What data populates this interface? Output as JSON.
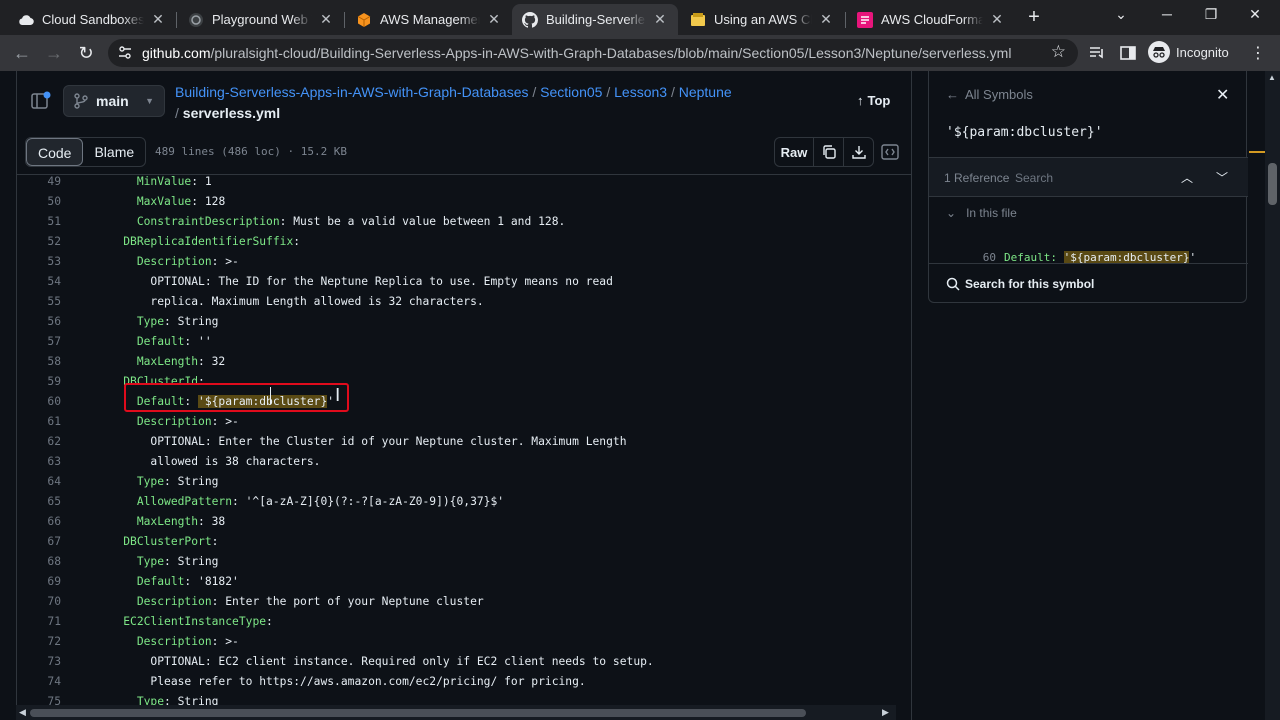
{
  "browser": {
    "tabs": [
      {
        "title": "Cloud Sandboxes - ",
        "icon": "cloud-icon",
        "active": false
      },
      {
        "title": "Playground Web Te",
        "icon": "playground-icon",
        "active": false
      },
      {
        "title": "AWS Management",
        "icon": "aws-cube-icon",
        "active": false
      },
      {
        "title": "Building-Serverless",
        "icon": "github-icon",
        "active": true
      },
      {
        "title": "Using an AWS Clou",
        "icon": "aws-doc-icon",
        "active": false
      },
      {
        "title": "AWS CloudFormatio",
        "icon": "cloudformation-icon",
        "active": false
      }
    ],
    "url_host": "github.com",
    "url_path": "/pluralsight-cloud/Building-Serverless-Apps-in-AWS-with-Graph-Databases/blob/main/Section05/Lesson3/Neptune/serverless.yml",
    "profile_label": "Incognito"
  },
  "repo": {
    "branch": "main",
    "breadcrumb": [
      {
        "label": "Building-Serverless-Apps-in-AWS-with-Graph-Databases"
      },
      {
        "label": "Section05"
      },
      {
        "label": "Lesson3"
      },
      {
        "label": "Neptune"
      }
    ],
    "separator": "/",
    "file_name": "serverless.yml",
    "top_label": "Top"
  },
  "file_toolbar": {
    "code_label": "Code",
    "blame_label": "Blame",
    "meta": "489 lines (486 loc) · 15.2 KB",
    "raw_label": "Raw"
  },
  "code_lines": [
    {
      "n": "49",
      "indent": "      ",
      "key": "MinValue",
      "rest": ": 1"
    },
    {
      "n": "50",
      "indent": "      ",
      "key": "MaxValue",
      "rest": ": 128"
    },
    {
      "n": "51",
      "indent": "      ",
      "key": "ConstraintDescription",
      "rest": ": Must be a valid value between 1 and 128."
    },
    {
      "n": "52",
      "indent": "    ",
      "key": "DBReplicaIdentifierSuffix",
      "rest": ":"
    },
    {
      "n": "53",
      "indent": "      ",
      "key": "Description",
      "rest": ": >-"
    },
    {
      "n": "54",
      "indent": "        ",
      "key": "",
      "rest": "OPTIONAL: The ID for the Neptune Replica to use. Empty means no read"
    },
    {
      "n": "55",
      "indent": "        ",
      "key": "",
      "rest": "replica. Maximum Length allowed is 32 characters."
    },
    {
      "n": "56",
      "indent": "      ",
      "key": "Type",
      "rest": ": String"
    },
    {
      "n": "57",
      "indent": "      ",
      "key": "Default",
      "rest": ": ''"
    },
    {
      "n": "58",
      "indent": "      ",
      "key": "MaxLength",
      "rest": ": 32"
    },
    {
      "n": "59",
      "indent": "    ",
      "key": "DBClusterId",
      "rest": ":"
    },
    {
      "n": "60",
      "indent": "      ",
      "key": "Default",
      "rest": ": ",
      "hl": "'${param:dbcluster}",
      "tail": "'"
    },
    {
      "n": "61",
      "indent": "      ",
      "key": "Description",
      "rest": ": >-"
    },
    {
      "n": "62",
      "indent": "        ",
      "key": "",
      "rest": "OPTIONAL: Enter the Cluster id of your Neptune cluster. Maximum Length"
    },
    {
      "n": "63",
      "indent": "        ",
      "key": "",
      "rest": "allowed is 38 characters."
    },
    {
      "n": "64",
      "indent": "      ",
      "key": "Type",
      "rest": ": String"
    },
    {
      "n": "65",
      "indent": "      ",
      "key": "AllowedPattern",
      "rest": ": '^[a-zA-Z]{0}(?:-?[a-zA-Z0-9]){0,37}$'"
    },
    {
      "n": "66",
      "indent": "      ",
      "key": "MaxLength",
      "rest": ": 38"
    },
    {
      "n": "67",
      "indent": "    ",
      "key": "DBClusterPort",
      "rest": ":"
    },
    {
      "n": "68",
      "indent": "      ",
      "key": "Type",
      "rest": ": String"
    },
    {
      "n": "69",
      "indent": "      ",
      "key": "Default",
      "rest": ": '8182'"
    },
    {
      "n": "70",
      "indent": "      ",
      "key": "Description",
      "rest": ": Enter the port of your Neptune cluster"
    },
    {
      "n": "71",
      "indent": "    ",
      "key": "EC2ClientInstanceType",
      "rest": ":"
    },
    {
      "n": "72",
      "indent": "      ",
      "key": "Description",
      "rest": ": >-"
    },
    {
      "n": "73",
      "indent": "        ",
      "key": "",
      "rest": "OPTIONAL: EC2 client instance. Required only if EC2 client needs to setup."
    },
    {
      "n": "74",
      "indent": "        ",
      "key": "",
      "rest": "Please refer to https://aws.amazon.com/ec2/pricing/ for pricing."
    },
    {
      "n": "75",
      "indent": "      ",
      "key": "Type",
      "rest": ": String"
    }
  ],
  "symbols": {
    "back_label": "All Symbols",
    "symbol_name": "'${param:dbcluster}'",
    "ref_count": "1 Reference",
    "search_placeholder": "Search",
    "in_this_file": "In this file",
    "ref_line_num": "60",
    "ref_key": "Default:",
    "ref_value": "'${param:dbcluster}",
    "ref_tail": "'",
    "search_symbol_label": "Search for this symbol"
  },
  "colors": {
    "accent_link": "#4493f8",
    "yaml_key": "#7ee787",
    "highlight": "#5a4a14",
    "annotation_box": "#e00b1c"
  }
}
